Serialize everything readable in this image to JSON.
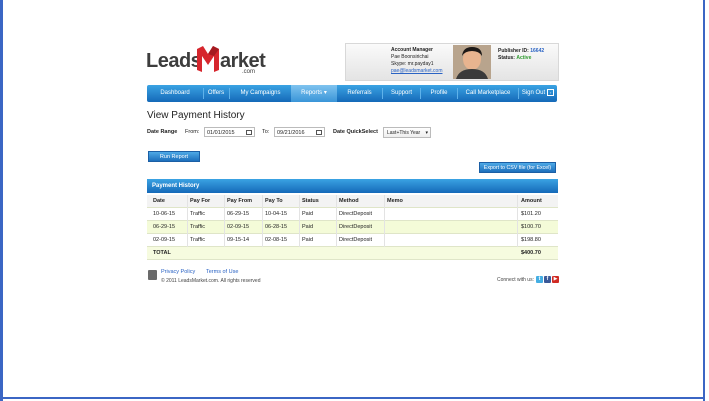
{
  "brand": {
    "leads": "Leads",
    "arket": "arket",
    "com": ".com"
  },
  "account": {
    "title": "Account Manager",
    "name": "Pae Boonsirichai",
    "skype": "Skype: mr.payday1",
    "email": "pae@leadsmarket.com",
    "publisher_label": "Publisher ID:",
    "publisher_id": "16642",
    "status_label": "Status:",
    "status": "Active"
  },
  "nav": {
    "items": [
      "Dashboard",
      "Offers",
      "My Campaigns",
      "Reports",
      "Referrals",
      "Support",
      "Profile",
      "Call Marketplace",
      "Sign Out"
    ],
    "active": "Reports"
  },
  "page": {
    "title": "View Payment History",
    "date_range_label": "Date Range",
    "from_label": "From:",
    "from_value": "01/01/2015",
    "to_label": "To:",
    "to_value": "09/21/2016",
    "quickselect_label": "Date QuickSelect",
    "quickselect_value": "Last+This Year",
    "run_button": "Run Report",
    "export_button": "Export to CSV file (for Excel)"
  },
  "table": {
    "title": "Payment History",
    "headers": [
      "Date",
      "Pay For",
      "Pay From",
      "Pay To",
      "Status",
      "Method",
      "Memo",
      "Amount"
    ],
    "rows": [
      [
        "10-06-15",
        "Traffic",
        "06-29-15",
        "10-04-15",
        "Paid",
        "DirectDeposit",
        "",
        "$101.20"
      ],
      [
        "06-29-15",
        "Traffic",
        "02-09-15",
        "06-28-15",
        "Paid",
        "DirectDeposit",
        "",
        "$100.70"
      ],
      [
        "02-09-15",
        "Traffic",
        "09-15-14",
        "02-08-15",
        "Paid",
        "DirectDeposit",
        "",
        "$198.80"
      ]
    ],
    "total_label": "TOTAL",
    "total_value": "$400.70"
  },
  "footer": {
    "privacy": "Privacy Policy",
    "terms": "Terms of Use",
    "copyright": "© 2011 LeadsMarket.com. All rights reserved",
    "connect": "Connect with us:"
  },
  "colors": {
    "accent": "#1e7dd0",
    "frame": "#3b66c4",
    "logo_red": "#d6262d"
  }
}
